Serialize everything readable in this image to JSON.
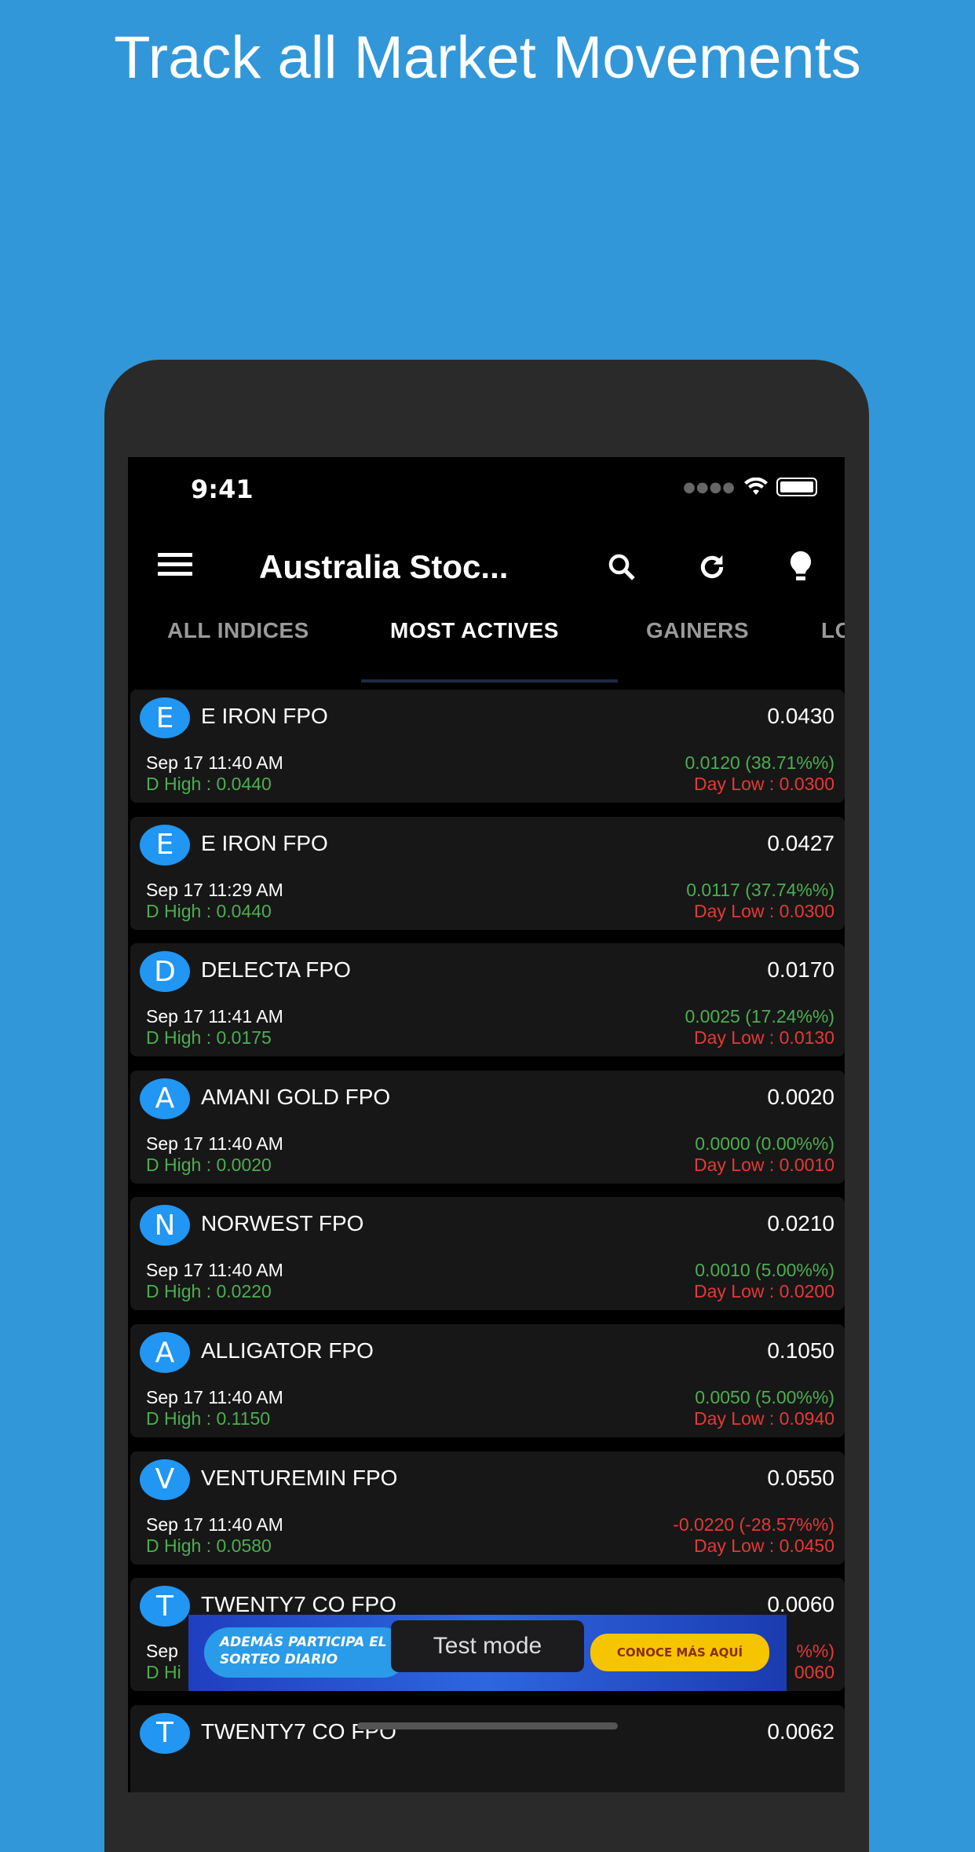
{
  "headline": "Track all Market Movements",
  "status_bar": {
    "time": "9:41"
  },
  "toolbar": {
    "title": "Australia Stoc...",
    "icons": [
      "menu-icon",
      "search-icon",
      "refresh-icon",
      "lightbulb-icon"
    ]
  },
  "tabs": [
    {
      "label": "ALL INDICES",
      "active": false
    },
    {
      "label": "MOST ACTIVES",
      "active": true
    },
    {
      "label": "GAINERS",
      "active": false
    },
    {
      "label": "LO",
      "active": false
    }
  ],
  "colors": {
    "background": "#3197d9",
    "avatar": "#2196f3",
    "up": "#4caf50",
    "down": "#e53935"
  },
  "rows": [
    {
      "initial": "E",
      "name": "E IRON FPO",
      "price": "0.0430",
      "date": "Sep 17 11:40 AM",
      "high": "D High : 0.0440",
      "change": "0.0120 (38.71%%)",
      "low": "Day Low : 0.0300",
      "dir": "up"
    },
    {
      "initial": "E",
      "name": "E IRON FPO",
      "price": "0.0427",
      "date": "Sep 17 11:29 AM",
      "high": "D High : 0.0440",
      "change": "0.0117 (37.74%%)",
      "low": "Day Low : 0.0300",
      "dir": "up"
    },
    {
      "initial": "D",
      "name": "DELECTA FPO",
      "price": "0.0170",
      "date": "Sep 17 11:41 AM",
      "high": "D High : 0.0175",
      "change": "0.0025 (17.24%%)",
      "low": "Day Low : 0.0130",
      "dir": "up"
    },
    {
      "initial": "A",
      "name": "AMANI GOLD FPO",
      "price": "0.0020",
      "date": "Sep 17 11:40 AM",
      "high": "D High : 0.0020",
      "change": "0.0000 (0.00%%)",
      "low": "Day Low : 0.0010",
      "dir": "up"
    },
    {
      "initial": "N",
      "name": "NORWEST FPO",
      "price": "0.0210",
      "date": "Sep 17 11:40 AM",
      "high": "D High : 0.0220",
      "change": "0.0010 (5.00%%)",
      "low": "Day Low : 0.0200",
      "dir": "up"
    },
    {
      "initial": "A",
      "name": "ALLIGATOR FPO",
      "price": "0.1050",
      "date": "Sep 17 11:40 AM",
      "high": "D High : 0.1150",
      "change": "0.0050 (5.00%%)",
      "low": "Day Low : 0.0940",
      "dir": "up"
    },
    {
      "initial": "V",
      "name": "VENTUREMIN FPO",
      "price": "0.0550",
      "date": "Sep 17 11:40 AM",
      "high": "D High : 0.0580",
      "change": "-0.0220 (-28.57%%)",
      "low": "Day Low : 0.0450",
      "dir": "down"
    },
    {
      "initial": "T",
      "name": "TWENTY7 CO FPO",
      "price": "0.0060",
      "date": "Sep",
      "high": "D Hi",
      "change": "%%)",
      "low": "0060",
      "dir": "down"
    },
    {
      "initial": "T",
      "name": "TWENTY7 CO FPO",
      "price": "0.0062"
    }
  ],
  "ad": {
    "left_text": "ADEMÁS PARTICIPA EL SORTEO DIARIO",
    "cta": "CONOCE MÁS AQUÍ",
    "toast": "Test mode"
  }
}
